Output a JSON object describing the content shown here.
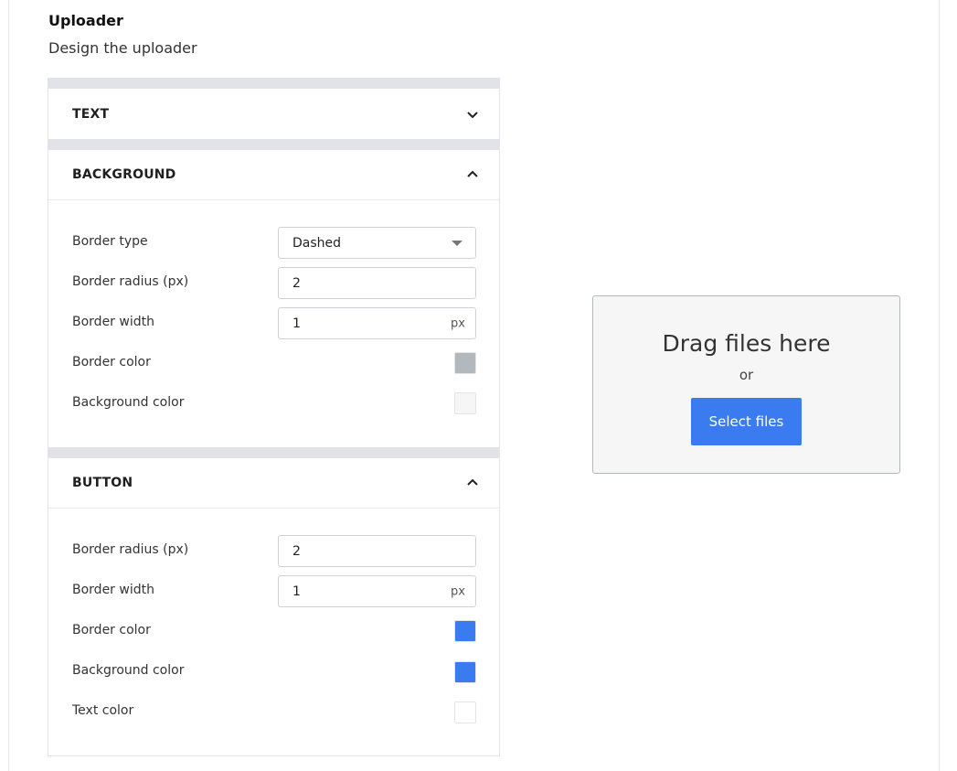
{
  "page": {
    "heading": "Uploader",
    "subheading": "Design the uploader"
  },
  "sections": {
    "text": {
      "title": "TEXT",
      "expanded": false
    },
    "background": {
      "title": "BACKGROUND",
      "expanded": true,
      "border_type_label": "Border type",
      "border_type_value": "Dashed",
      "border_radius_label": "Border radius (px)",
      "border_radius_value": "2",
      "border_width_label": "Border width",
      "border_width_value": "1",
      "border_width_unit": "px",
      "border_color_label": "Border color",
      "border_color_value": "#b3b8bd",
      "background_color_label": "Background color",
      "background_color_value": "#f6f6f6"
    },
    "button": {
      "title": "BUTTON",
      "expanded": true,
      "border_radius_label": "Border radius (px)",
      "border_radius_value": "2",
      "border_width_label": "Border width",
      "border_width_value": "1",
      "border_width_unit": "px",
      "border_color_label": "Border color",
      "border_color_value": "#3a7bf0",
      "background_color_label": "Background color",
      "background_color_value": "#3a7bf0",
      "text_color_label": "Text color",
      "text_color_value": "#ffffff"
    }
  },
  "preview": {
    "drag_text": "Drag files here",
    "or_text": "or",
    "button_label": "Select files"
  },
  "icons": {
    "collapsed": "chevron-down-icon",
    "expanded": "chevron-up-icon",
    "dropdown": "caret-down-icon"
  }
}
